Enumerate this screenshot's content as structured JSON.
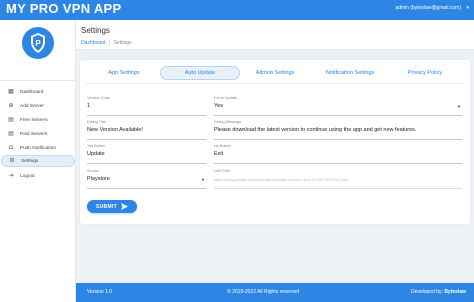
{
  "app": {
    "title": "MY PRO VPN APP",
    "user_email": "admin (byteslaw@gmail.com)"
  },
  "colors": {
    "primary": "#2d86e3",
    "background": "#eef1f6",
    "active_nav_bg": "#e4eefb"
  },
  "sidebar": {
    "logo_icon": "shield-p-logo",
    "items": [
      {
        "label": "Dashboard",
        "icon": "dashboard-grid-icon"
      },
      {
        "label": "Add Server",
        "icon": "add-circle-icon"
      },
      {
        "label": "Free Servers",
        "icon": "server-icon"
      },
      {
        "label": "Paid Servers",
        "icon": "server-icon"
      },
      {
        "label": "Push Notification",
        "icon": "bell-icon"
      },
      {
        "label": "Settings",
        "icon": "gear-icon",
        "active": true
      },
      {
        "label": "Logout",
        "icon": "logout-icon"
      }
    ]
  },
  "header": {
    "title": "Settings",
    "breadcrumb": {
      "home": "Dashboard",
      "separator": "|",
      "current": "Settings"
    }
  },
  "tabs": [
    {
      "label": "App Settings"
    },
    {
      "label": "Auto Update",
      "active": true
    },
    {
      "label": "Admob Settings"
    },
    {
      "label": "Notification Settings"
    },
    {
      "label": "Privacy Policy"
    }
  ],
  "form": {
    "version_code": {
      "label": "Version Code",
      "value": "1"
    },
    "force_update": {
      "label": "Force Update",
      "value": "Yes"
    },
    "dialog_title": {
      "label": "Dialog Title",
      "value": "New Version Available!"
    },
    "dialog_message": {
      "label": "Dialog Message",
      "value": "Please download the latest version to continue using the app and get new features."
    },
    "yes_button": {
      "label": "Yes Button",
      "value": "Update"
    },
    "no_button": {
      "label": "No Button",
      "value": "Exit"
    },
    "source": {
      "label": "Source",
      "value": "Playstore"
    },
    "link_path": {
      "label": "Link Path",
      "placeholder": "https://play.google.com/store/apps/details?id=com.your.id OR Full APK path"
    },
    "submit_label": "SUBMIT"
  },
  "footer": {
    "version": "Version 1.0",
    "copyright": "© 2019-2022 All Rights reserved",
    "developed_by": "Developed by:",
    "developer": "Byteslaw"
  }
}
